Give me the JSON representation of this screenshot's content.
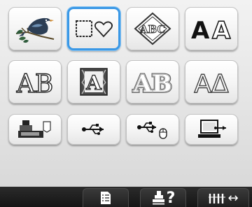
{
  "buttons": {
    "row1": [
      {
        "name": "bird-pattern-button",
        "icon": "bird-embroidery-icon"
      },
      {
        "name": "frame-pattern-button",
        "icon": "square-heart-frame-icon",
        "selected": true
      },
      {
        "name": "monogram-button",
        "icon": "abc-diamond-monogram-icon",
        "text": "ABC"
      },
      {
        "name": "large-alphabet-button",
        "icon": "block-letters-icon",
        "text": "AA"
      }
    ],
    "row2": [
      {
        "name": "outline-font-button",
        "icon": "ab-outline-font-icon",
        "text": "AB"
      },
      {
        "name": "decorative-letter-button",
        "icon": "ornate-a-icon",
        "text": "A"
      },
      {
        "name": "double-outline-font-button",
        "icon": "ab-double-outline-icon",
        "text": "AB"
      },
      {
        "name": "greek-letter-button",
        "icon": "alpha-delta-icon",
        "text": "AΔ"
      }
    ],
    "row3": [
      {
        "name": "machine-memory-button",
        "icon": "embroidery-machine-icon"
      },
      {
        "name": "usb-button",
        "icon": "usb-icon"
      },
      {
        "name": "usb-mouse-button",
        "icon": "usb-mouse-icon"
      },
      {
        "name": "computer-button",
        "icon": "computer-usb-icon"
      }
    ]
  },
  "bottombar": {
    "settings_icon": "settings-list-icon",
    "help_text": "?",
    "help_icon": "machine-help-icon",
    "thread_icon": "thread-spool-icon",
    "thread_arrow": "↔"
  },
  "colors": {
    "selection": "#3a98e6",
    "bar": "#1a1a1a"
  }
}
